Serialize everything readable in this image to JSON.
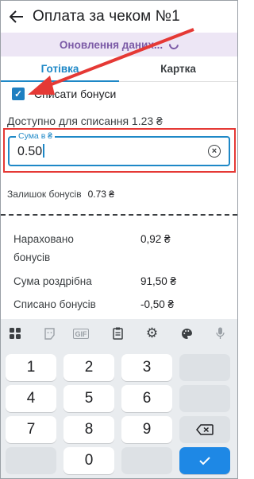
{
  "header": {
    "title": "Оплата за чеком №1"
  },
  "sync": {
    "text": "Оновлення даних..."
  },
  "tabs": [
    {
      "label": "Готівка"
    },
    {
      "label": "Картка"
    }
  ],
  "bonus": {
    "checkbox_label": "Списати бонуси",
    "available_text": "Доступно для списання 1.23 ₴"
  },
  "amount_field": {
    "label": "Сума в ₴",
    "value": "0.50"
  },
  "balance": {
    "label": "Залишок бонусів",
    "value": "0.73 ₴"
  },
  "summary": [
    {
      "label_line1": "Нараховано",
      "label_line2": "бонусів",
      "value": "0,92 ₴"
    },
    {
      "label_line1": "Сума роздрібна",
      "value": "91,50 ₴"
    },
    {
      "label_line1": "Списано бонусів",
      "value": "-0,50 ₴"
    }
  ],
  "keyboard": {
    "toolbar_icons": [
      "apps-grid-icon",
      "sticker-icon",
      "gif-icon",
      "clipboard-icon",
      "gear-icon",
      "palette-icon",
      "microphone-icon"
    ],
    "gif_label": "GIF",
    "keys": [
      "1",
      "2",
      "3",
      "4",
      "5",
      "6",
      "7",
      "8",
      "9",
      "0"
    ],
    "accent": "#1e88e5"
  },
  "annotation": {
    "color": "#e53935"
  }
}
